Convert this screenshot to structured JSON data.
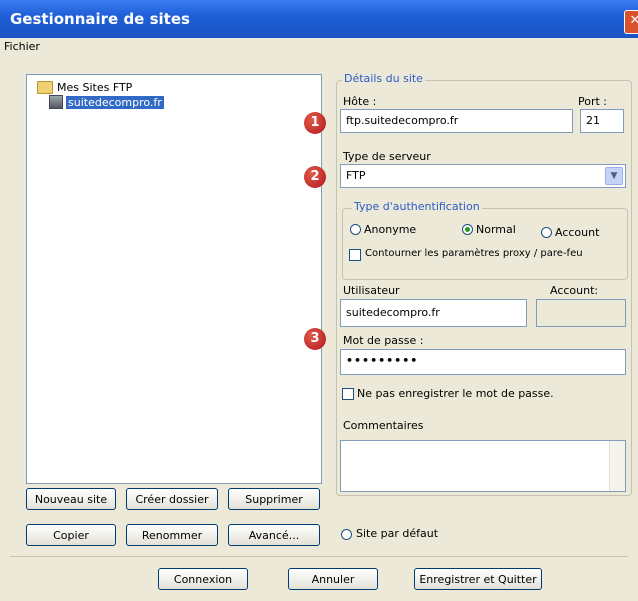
{
  "window": {
    "title": "Gestionnaire de sites",
    "close_glyph": "✕"
  },
  "menu": {
    "file": "Fichier"
  },
  "tree": {
    "root_label": "Mes Sites FTP",
    "site_label": "suitedecompro.fr"
  },
  "left_buttons": {
    "new_site": "Nouveau site",
    "new_folder": "Créer dossier",
    "delete": "Supprimer",
    "copy": "Copier",
    "rename": "Renommer",
    "advanced": "Avancé..."
  },
  "details": {
    "group_title": "Détails du site",
    "host_label": "Hôte :",
    "host_value": "ftp.suitedecompro.fr",
    "port_label": "Port :",
    "port_value": "21",
    "server_type_label": "Type de serveur",
    "server_type_value": "FTP",
    "auth_group_title": "Type d'authentification",
    "auth_options": [
      "Anonyme",
      "Normal",
      "Account"
    ],
    "auth_selected": "Normal",
    "bypass_proxy_label": "Contourner les paramètres proxy / pare-feu",
    "user_label": "Utilisateur",
    "user_value": "suitedecompro.fr",
    "account_label": "Account:",
    "password_label": "Mot de passe :",
    "password_value": "•••••••••",
    "dont_save_password_label": "Ne pas enregistrer le mot de passe.",
    "comments_label": "Commentaires",
    "default_site_label": "Site par défaut"
  },
  "badges": [
    "1",
    "2",
    "3"
  ],
  "bottom_buttons": {
    "connect": "Connexion",
    "cancel": "Annuler",
    "save_quit": "Enregistrer et Quitter"
  },
  "colors": {
    "title_bar": "#1f5fd8",
    "selection": "#316ac5",
    "badge": "#b0181a",
    "group_title": "#2d5bc6"
  }
}
